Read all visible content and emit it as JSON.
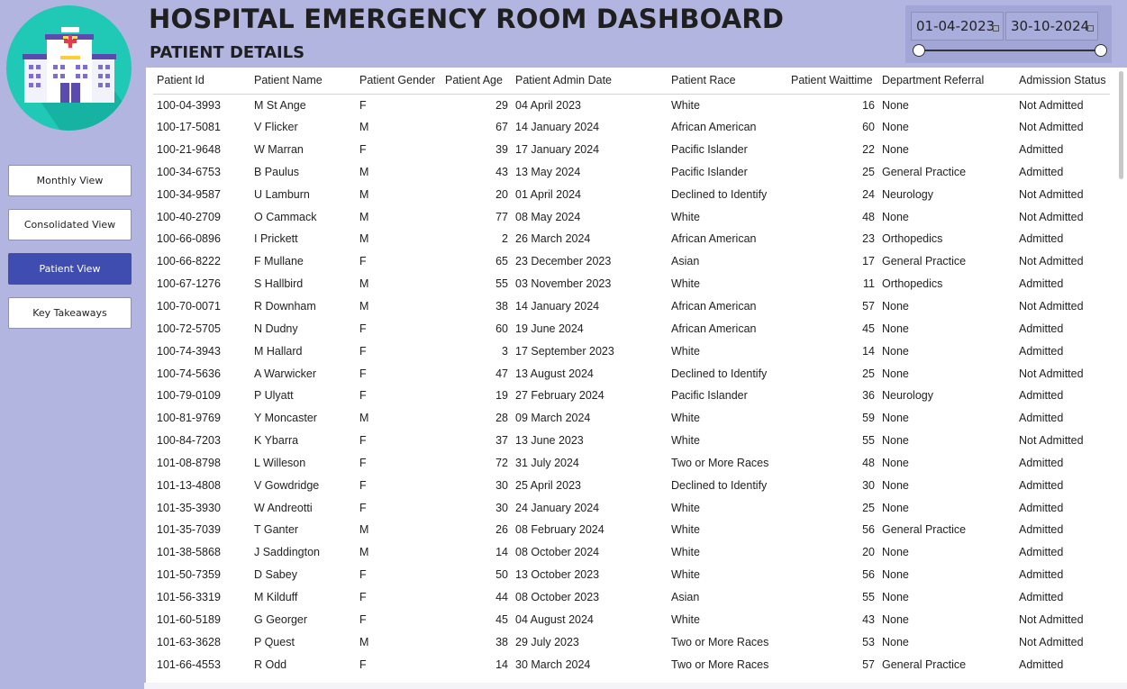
{
  "header": {
    "title": "HOSPITAL EMERGENCY ROOM DASHBOARD",
    "subtitle": "PATIENT DETAILS"
  },
  "date_filter": {
    "start": "01-04-2023",
    "end": "30-10-2024"
  },
  "nav": [
    {
      "label": "Monthly View",
      "active": false
    },
    {
      "label": "Consolidated View",
      "active": false
    },
    {
      "label": "Patient View",
      "active": true
    },
    {
      "label": "Key Takeaways",
      "active": false
    }
  ],
  "table": {
    "columns": [
      "Patient Id",
      "Patient Name",
      "Patient Gender",
      "Patient Age",
      "Patient Admin Date",
      "Patient Race",
      "Patient Waittime",
      "Department Referral",
      "Admission Status"
    ],
    "rows": [
      [
        "100-04-3993",
        "M St Ange",
        "F",
        "29",
        "04 April 2023",
        "White",
        "16",
        "None",
        "Not Admitted"
      ],
      [
        "100-17-5081",
        "V Flicker",
        "M",
        "67",
        "14 January 2024",
        "African American",
        "60",
        "None",
        "Not Admitted"
      ],
      [
        "100-21-9648",
        "W Marran",
        "F",
        "39",
        "17 January 2024",
        "Pacific Islander",
        "22",
        "None",
        "Admitted"
      ],
      [
        "100-34-6753",
        "B Paulus",
        "M",
        "43",
        "13 May 2024",
        "Pacific Islander",
        "25",
        "General Practice",
        "Admitted"
      ],
      [
        "100-34-9587",
        "U Lamburn",
        "M",
        "20",
        "01 April 2024",
        "Declined to Identify",
        "24",
        "Neurology",
        "Not Admitted"
      ],
      [
        "100-40-2709",
        "O Cammack",
        "M",
        "77",
        "08 May 2024",
        "White",
        "48",
        "None",
        "Not Admitted"
      ],
      [
        "100-66-0896",
        "I Prickett",
        "M",
        "2",
        "26 March 2024",
        "African American",
        "23",
        "Orthopedics",
        "Admitted"
      ],
      [
        "100-66-8222",
        "F Mullane",
        "F",
        "65",
        "23 December 2023",
        "Asian",
        "17",
        "General Practice",
        "Not Admitted"
      ],
      [
        "100-67-1276",
        "S Hallbird",
        "M",
        "55",
        "03 November 2023",
        "White",
        "11",
        "Orthopedics",
        "Admitted"
      ],
      [
        "100-70-0071",
        "R Downham",
        "M",
        "38",
        "14 January 2024",
        "African American",
        "57",
        "None",
        "Not Admitted"
      ],
      [
        "100-72-5705",
        "N Dudny",
        "F",
        "60",
        "19 June 2024",
        "African American",
        "45",
        "None",
        "Admitted"
      ],
      [
        "100-74-3943",
        "M Hallard",
        "F",
        "3",
        "17 September 2023",
        "White",
        "14",
        "None",
        "Admitted"
      ],
      [
        "100-74-5636",
        "A Warwicker",
        "F",
        "47",
        "13 August 2024",
        "Declined to Identify",
        "25",
        "None",
        "Not Admitted"
      ],
      [
        "100-79-0109",
        "P Ulyatt",
        "F",
        "19",
        "27 February 2024",
        "Pacific Islander",
        "36",
        "Neurology",
        "Admitted"
      ],
      [
        "100-81-9769",
        "Y Moncaster",
        "M",
        "28",
        "09 March 2024",
        "White",
        "59",
        "None",
        "Admitted"
      ],
      [
        "100-84-7203",
        "K Ybarra",
        "F",
        "37",
        "13 June 2023",
        "White",
        "55",
        "None",
        "Not Admitted"
      ],
      [
        "101-08-8798",
        "L Willeson",
        "F",
        "72",
        "31 July 2024",
        "Two or More Races",
        "48",
        "None",
        "Admitted"
      ],
      [
        "101-13-4808",
        "V Gowdridge",
        "F",
        "30",
        "25 April 2023",
        "Declined to Identify",
        "30",
        "None",
        "Admitted"
      ],
      [
        "101-35-3930",
        "W Andreotti",
        "F",
        "30",
        "24 January 2024",
        "White",
        "25",
        "None",
        "Admitted"
      ],
      [
        "101-35-7039",
        "T Ganter",
        "M",
        "26",
        "08 February 2024",
        "White",
        "56",
        "General Practice",
        "Admitted"
      ],
      [
        "101-38-5868",
        "J Saddington",
        "M",
        "14",
        "08 October 2024",
        "White",
        "20",
        "None",
        "Admitted"
      ],
      [
        "101-50-7359",
        "D Sabey",
        "F",
        "50",
        "13 October 2023",
        "White",
        "56",
        "None",
        "Admitted"
      ],
      [
        "101-56-3319",
        "M Kilduff",
        "F",
        "44",
        "08 October 2023",
        "Asian",
        "55",
        "None",
        "Admitted"
      ],
      [
        "101-60-5189",
        "G Georger",
        "F",
        "45",
        "04 August 2024",
        "White",
        "43",
        "None",
        "Not Admitted"
      ],
      [
        "101-63-3628",
        "P Quest",
        "M",
        "38",
        "29 July 2023",
        "Two or More Races",
        "53",
        "None",
        "Not Admitted"
      ],
      [
        "101-66-4553",
        "R Odd",
        "F",
        "14",
        "30 March 2024",
        "Two or More Races",
        "57",
        "General Practice",
        "Admitted"
      ]
    ]
  },
  "colors": {
    "background": "#b1b5df",
    "active_button": "#3f4db0",
    "logo_circle": "#1fc9b6"
  }
}
